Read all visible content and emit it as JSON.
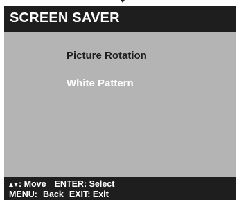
{
  "header": {
    "title": "SCREEN SAVER"
  },
  "menu": {
    "items": [
      {
        "label": "Picture Rotation",
        "selected": false
      },
      {
        "label": "White Pattern",
        "selected": true
      }
    ]
  },
  "footer": {
    "move_icon": "up-down-arrows-icon",
    "move_label": ": Move",
    "enter_label": "ENTER: Select",
    "menu_label": "MENU:",
    "back_label": "Back",
    "exit_label": "EXIT: Exit"
  },
  "colors": {
    "panel_background": "#b4b4b4",
    "bar_background": "#1e1e1e",
    "item_normal": "#1e1e1e",
    "item_selected": "#ffffff"
  }
}
